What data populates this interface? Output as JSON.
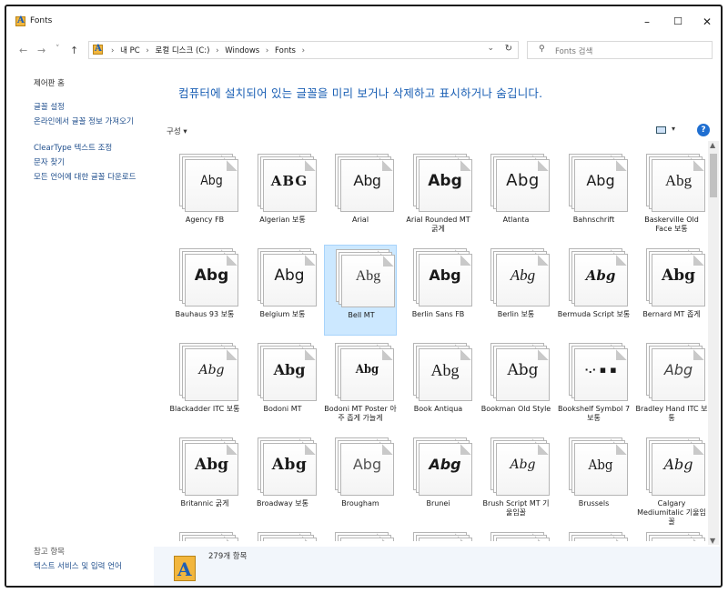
{
  "window": {
    "title": "Fonts",
    "min_label": "–",
    "max_label": "☐",
    "close_label": "✕"
  },
  "nav": {
    "back": "←",
    "forward": "→",
    "recent": "˅",
    "up": "↑",
    "breadcrumb": [
      "내 PC",
      "로컬 디스크 (C:)",
      "Windows",
      "Fonts"
    ],
    "sep": "›",
    "dropdown": "⌄",
    "refresh": "↻",
    "search_placeholder": "Fonts 검색",
    "search_icon": "⚲"
  },
  "left_pane": {
    "home": "제어판 홈",
    "links": [
      "글꼴 설정",
      "온라인에서 글꼴 정보 가져오기",
      "ClearType 텍스트 조정",
      "문자 찾기",
      "모든 언어에 대한 글꼴 다운로드"
    ],
    "see_also": "참고 항목",
    "see_also_links": [
      "텍스트 서비스 및 입력 언어"
    ]
  },
  "main": {
    "headline": "컴퓨터에 설치되어 있는 글꼴을 미리 보거나 삭제하고 표시하거나 숨깁니다.",
    "organize": "구성 ▾",
    "view_dropdown": "▾",
    "help": "?"
  },
  "fonts": [
    {
      "name": "Agency FB",
      "sample": "Abg",
      "selected": false
    },
    {
      "name": "Algerian 보통",
      "sample": "ABG",
      "selected": false
    },
    {
      "name": "Arial",
      "sample": "Abg",
      "selected": false
    },
    {
      "name": "Arial Rounded MT 굵게",
      "sample": "Abg",
      "selected": false
    },
    {
      "name": "Atlanta",
      "sample": "Abg",
      "selected": false
    },
    {
      "name": "Bahnschrift",
      "sample": "Abg",
      "selected": false
    },
    {
      "name": "Baskerville Old Face 보통",
      "sample": "Abg",
      "selected": false
    },
    {
      "name": "Bauhaus 93 보통",
      "sample": "Abg",
      "selected": false
    },
    {
      "name": "Belgium 보통",
      "sample": "Abg",
      "selected": false
    },
    {
      "name": "Bell MT",
      "sample": "Abg",
      "selected": true
    },
    {
      "name": "Berlin Sans FB",
      "sample": "Abg",
      "selected": false
    },
    {
      "name": "Berlin 보통",
      "sample": "Abg",
      "selected": false
    },
    {
      "name": "Bermuda Script 보통",
      "sample": "Abg",
      "selected": false
    },
    {
      "name": "Bernard MT 좁게",
      "sample": "Abg",
      "selected": false
    },
    {
      "name": "Blackadder ITC 보통",
      "sample": "Abg",
      "selected": false
    },
    {
      "name": "Bodoni MT",
      "sample": "Abg",
      "selected": false
    },
    {
      "name": "Bodoni MT Poster 아주 좁게 가늘게",
      "sample": "Abg",
      "selected": false
    },
    {
      "name": "Book Antiqua",
      "sample": "Abg",
      "selected": false
    },
    {
      "name": "Bookman Old Style",
      "sample": "Abg",
      "selected": false
    },
    {
      "name": "Bookshelf Symbol 7 보통",
      "sample": "·.·  ▪  ▪",
      "selected": false
    },
    {
      "name": "Bradley Hand ITC 보통",
      "sample": "Abg",
      "selected": false
    },
    {
      "name": "Britannic 굵게",
      "sample": "Abg",
      "selected": false
    },
    {
      "name": "Broadway 보통",
      "sample": "Abg",
      "selected": false
    },
    {
      "name": "Brougham",
      "sample": "Abg",
      "selected": false
    },
    {
      "name": "Brunei",
      "sample": "Abg",
      "selected": false
    },
    {
      "name": "Brush Script MT 기울임꼴",
      "sample": "Abg",
      "selected": false
    },
    {
      "name": "Brussels",
      "sample": "Abg",
      "selected": false
    },
    {
      "name": "Calgary Mediumitalic 기울임꼴",
      "sample": "Abg",
      "selected": false
    }
  ],
  "details": {
    "count": "279개 항목"
  }
}
